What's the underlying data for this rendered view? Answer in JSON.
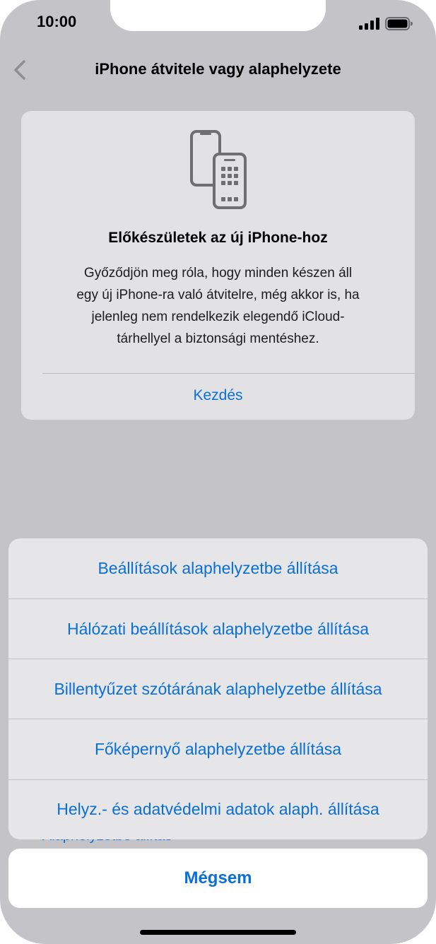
{
  "status_bar": {
    "time": "10:00"
  },
  "nav": {
    "title": "iPhone átvitele vagy alaphelyzete"
  },
  "card": {
    "title": "Előkészületek az új iPhone-hoz",
    "lines": [
      "Győződjön meg róla, hogy minden készen áll",
      "egy új iPhone-ra való átvitelre, még akkor is, ha",
      "jelenleg nem rendelkezik elegendő iCloud-",
      "tárhellyel a biztonsági mentéshez."
    ],
    "link": "Kezdés"
  },
  "background_peek": {
    "text": "Alaphelyzetbe állítás"
  },
  "action_sheet": {
    "items": [
      {
        "label": "Beállítások alaphelyzetbe állítása"
      },
      {
        "label": "Hálózati beállítások alaphelyzetbe állítása"
      },
      {
        "label": "Billentyűzet szótárának alaphelyzetbe állítása"
      },
      {
        "label": "Főképernyő alaphelyzetbe állítása"
      },
      {
        "label": "Helyz.- és adatvédelmi adatok alaph. állítása"
      }
    ],
    "cancel": "Mégsem"
  },
  "colors": {
    "accent": "#0a6fd6",
    "dimmed_background": "#c4c4c8"
  },
  "icons": {
    "back": "chevron-left-icon",
    "card": "phone-transfer-icon",
    "signal": "cellular-signal-icon",
    "battery": "battery-icon"
  }
}
